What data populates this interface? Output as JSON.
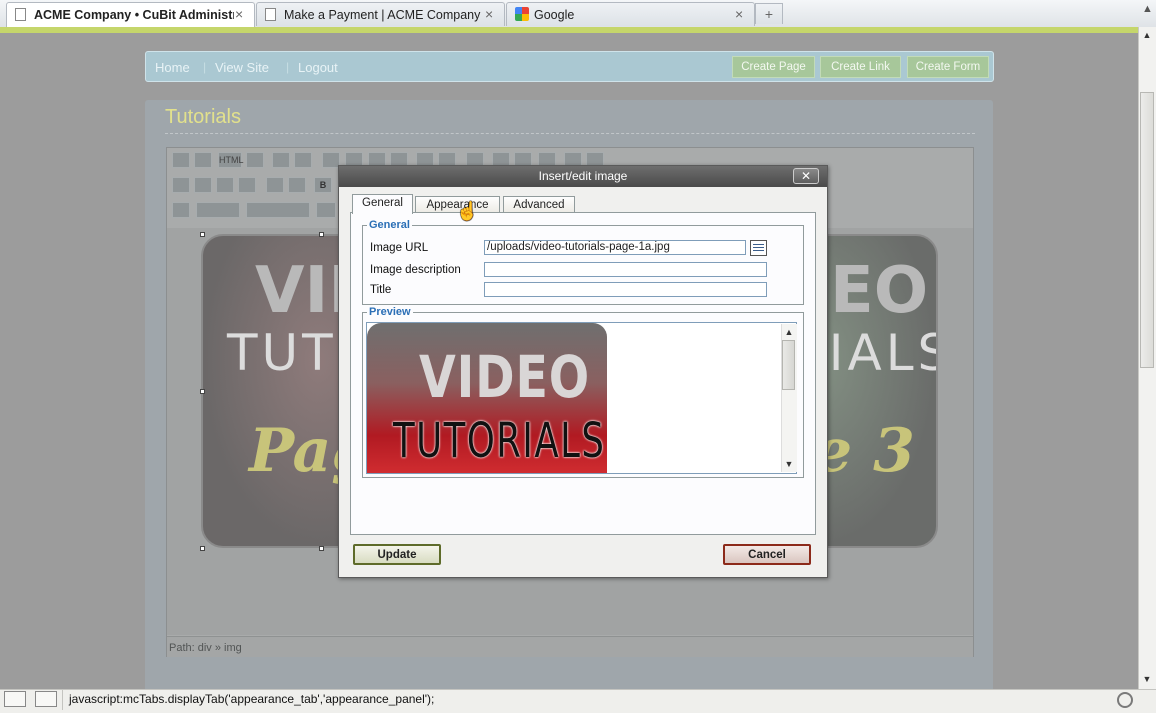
{
  "browser": {
    "tabs": [
      {
        "label": "ACME Company • CuBit Administr...",
        "active": true
      },
      {
        "label": "Make a Payment | ACME Company",
        "active": false
      },
      {
        "label": "Google",
        "active": false
      }
    ],
    "close_glyph": "×",
    "new_tab_glyph": "+"
  },
  "nav": {
    "links": [
      "Home",
      "View Site",
      "Logout"
    ],
    "buttons": [
      "Create Page",
      "Create Link",
      "Create Form"
    ]
  },
  "panel": {
    "title": "Tutorials",
    "path": "Path: div » img"
  },
  "toolbar": {
    "html_label": "HTML",
    "bold_label": "B"
  },
  "background_images": {
    "left": {
      "line1": "VIDE",
      "line2": "TUTOR",
      "line3": "Page"
    },
    "right": {
      "line1": "EO",
      "line2": "RIALS",
      "line3": "e 3"
    }
  },
  "dialog": {
    "title": "Insert/edit image",
    "close_glyph": "✕",
    "tabs": [
      "General",
      "Appearance",
      "Advanced"
    ],
    "active_tab": "General",
    "general_legend": "General",
    "fields": {
      "image_url_label": "Image URL",
      "image_url_value": "/uploads/video-tutorials-page-1a.jpg",
      "image_description_label": "Image description",
      "image_description_value": "",
      "title_label": "Title",
      "title_value": ""
    },
    "preview_legend": "Preview",
    "preview_text1": "VIDEO",
    "preview_text2": "TUTORIALS",
    "update_label": "Update",
    "cancel_label": "Cancel"
  },
  "statusbar": {
    "text": "javascript:mcTabs.displayTab('appearance_tab','appearance_panel');"
  },
  "colors": {
    "nav_bar": "#aac8d2",
    "nav_button": "#a7c79a",
    "title_yellow": "#e2e18c",
    "legend_blue": "#2b6fb6",
    "dialog_title_bar": "#4a4a4a"
  }
}
